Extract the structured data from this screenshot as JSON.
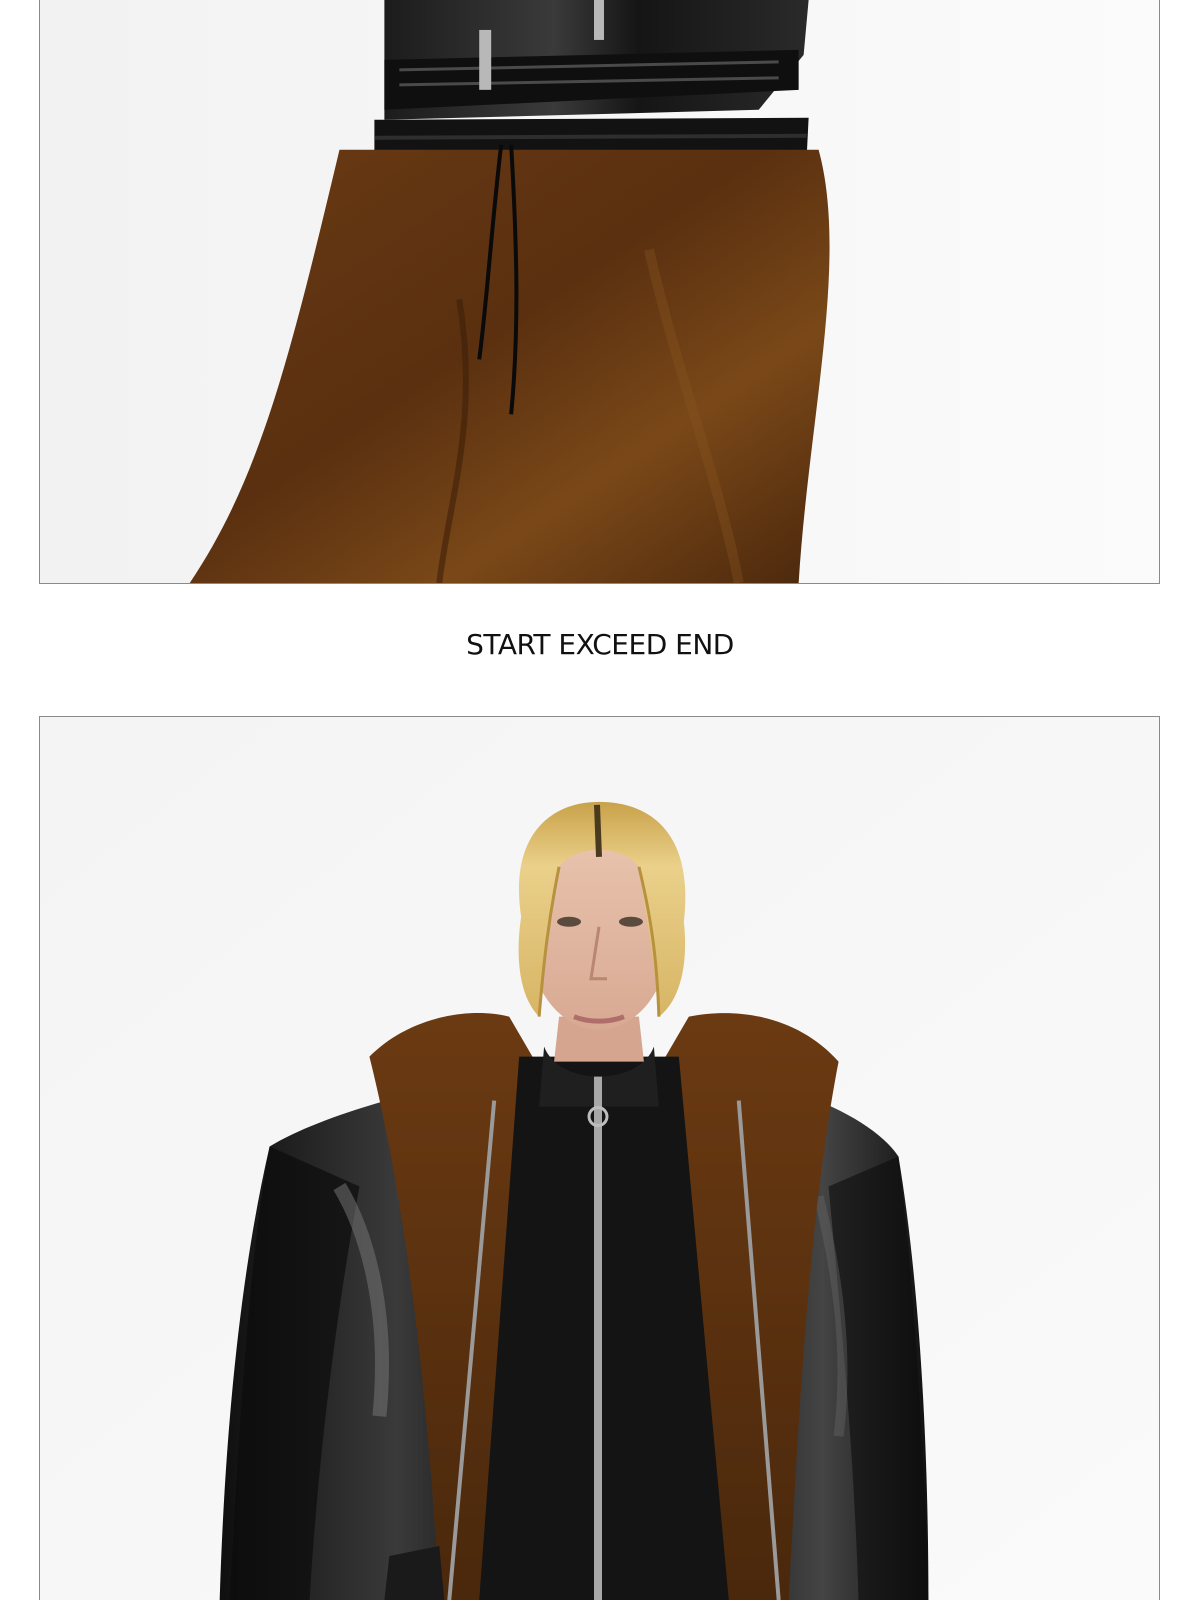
{
  "caption": "START EXCEED END",
  "photos": [
    {
      "name": "top-photo",
      "depicts": "fur trousers with drawstring and leather jacket hem"
    },
    {
      "name": "bottom-photo",
      "depicts": "model in black leather bomber jacket with brown fur collar"
    }
  ],
  "colors": {
    "background": "#ffffff",
    "frame_border": "#8a8a8a",
    "caption_text": "#111111",
    "fur_brown": "#5e3412",
    "leather_black": "#141414",
    "hair_blonde": "#e3c477"
  }
}
